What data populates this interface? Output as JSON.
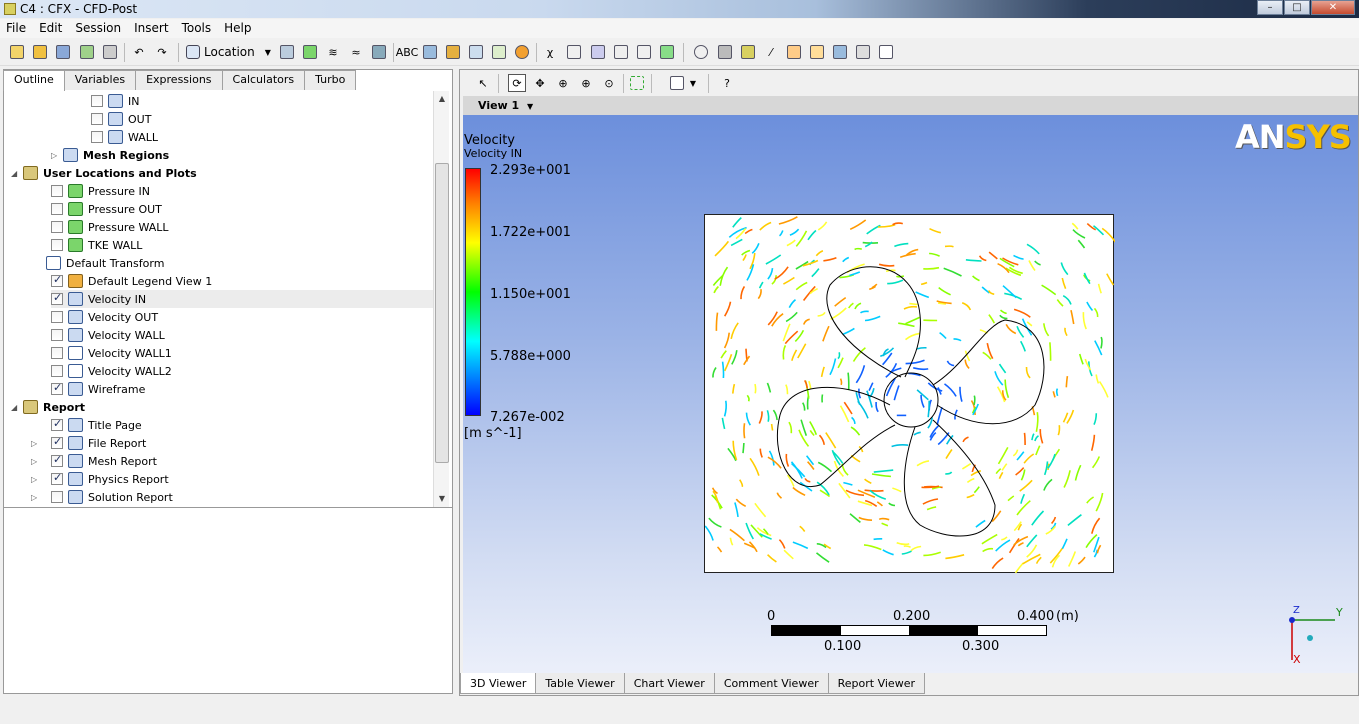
{
  "window": {
    "title": "C4 : CFX - CFD-Post"
  },
  "menu": [
    "File",
    "Edit",
    "Session",
    "Insert",
    "Tools",
    "Help"
  ],
  "toolbar": {
    "location_label": "Location"
  },
  "tabs": [
    "Outline",
    "Variables",
    "Expressions",
    "Calculators",
    "Turbo"
  ],
  "tree": [
    {
      "label": "IN",
      "checked": false,
      "bold": false
    },
    {
      "label": "OUT",
      "checked": false,
      "bold": false
    },
    {
      "label": "WALL",
      "checked": false,
      "bold": false
    },
    {
      "label": "Mesh Regions",
      "checked": null,
      "bold": true
    },
    {
      "label": "User Locations and Plots",
      "checked": null,
      "bold": true
    },
    {
      "label": "Pressure IN",
      "checked": false,
      "bold": false
    },
    {
      "label": "Pressure OUT",
      "checked": false,
      "bold": false
    },
    {
      "label": "Pressure WALL",
      "checked": false,
      "bold": false
    },
    {
      "label": "TKE WALL",
      "checked": false,
      "bold": false
    },
    {
      "label": "Default Transform",
      "checked": null,
      "bold": false
    },
    {
      "label": "Default Legend View 1",
      "checked": true,
      "bold": false
    },
    {
      "label": "Velocity IN",
      "checked": true,
      "bold": false
    },
    {
      "label": "Velocity OUT",
      "checked": false,
      "bold": false
    },
    {
      "label": "Velocity WALL",
      "checked": false,
      "bold": false
    },
    {
      "label": "Velocity WALL1",
      "checked": false,
      "bold": false
    },
    {
      "label": "Velocity WALL2",
      "checked": false,
      "bold": false
    },
    {
      "label": "Wireframe",
      "checked": true,
      "bold": false
    },
    {
      "label": "Report",
      "checked": null,
      "bold": true
    },
    {
      "label": "Title Page",
      "checked": true,
      "bold": false
    },
    {
      "label": "File Report",
      "checked": true,
      "bold": false
    },
    {
      "label": "Mesh Report",
      "checked": true,
      "bold": false
    },
    {
      "label": "Physics Report",
      "checked": true,
      "bold": false
    },
    {
      "label": "Solution Report",
      "checked": false,
      "bold": false
    }
  ],
  "viewer": {
    "view_label": "View 1",
    "logo_a": "AN",
    "logo_b": "SYS",
    "legend": {
      "title": "Velocity",
      "subtitle": "Velocity IN",
      "ticks": [
        "2.293e+001",
        "1.722e+001",
        "1.150e+001",
        "5.788e+000",
        "7.267e-002"
      ],
      "units": "[m s^-1]"
    },
    "scale": {
      "top": [
        "0",
        "0.200",
        "0.400",
        "(m)"
      ],
      "bottom": [
        "0.100",
        "0.300"
      ]
    },
    "axes": {
      "y": "Y",
      "z": "Z",
      "x": "X"
    }
  },
  "bottom_tabs": [
    "3D Viewer",
    "Table Viewer",
    "Chart Viewer",
    "Comment Viewer",
    "Report Viewer"
  ],
  "colors": {
    "legend_max": "#ff0000",
    "legend_min": "#0000ff",
    "viewport_top": "#6c8fdc",
    "logo_accent": "#f5c000"
  }
}
